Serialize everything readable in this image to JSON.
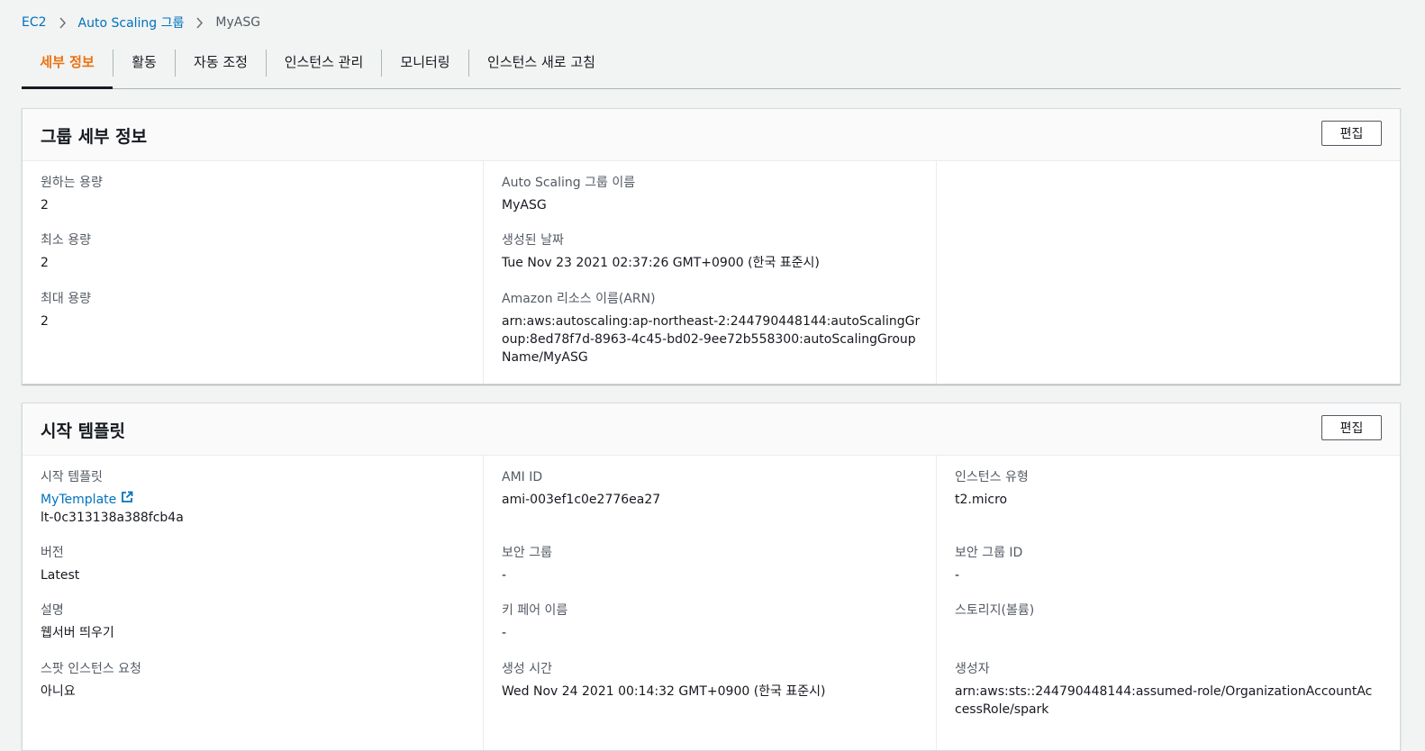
{
  "breadcrumb": {
    "items": [
      "EC2",
      "Auto Scaling 그룹"
    ],
    "current": "MyASG"
  },
  "tabs": [
    {
      "label": "세부 정보",
      "active": true
    },
    {
      "label": "활동"
    },
    {
      "label": "자동 조정"
    },
    {
      "label": "인스턴스 관리"
    },
    {
      "label": "모니터링"
    },
    {
      "label": "인스턴스 새로 고침"
    }
  ],
  "group_details": {
    "title": "그룹 세부 정보",
    "edit_label": "편집",
    "desired_label": "원하는 용량",
    "desired_value": "2",
    "min_label": "최소 용량",
    "min_value": "2",
    "max_label": "최대 용량",
    "max_value": "2",
    "name_label": "Auto Scaling 그룹 이름",
    "name_value": "MyASG",
    "created_label": "생성된 날짜",
    "created_value": "Tue Nov 23 2021 02:37:26 GMT+0900 (한국 표준시)",
    "arn_label": "Amazon 리소스 이름(ARN)",
    "arn_value": "arn:aws:autoscaling:ap-northeast-2:244790448144:autoScalingGroup:8ed78f7d-8963-4c45-bd02-9ee72b558300:autoScalingGroupName/MyASG"
  },
  "launch_template": {
    "title": "시작 템플릿",
    "edit_label": "편집",
    "template_label": "시작 템플릿",
    "template_name": "MyTemplate",
    "template_id": "lt-0c313138a388fcb4a",
    "version_label": "버전",
    "version_value": "Latest",
    "description_label": "설명",
    "description_value": "웹서버 띄우기",
    "spot_label": "스팟 인스턴스 요청",
    "spot_value": "아니요",
    "ami_label": "AMI ID",
    "ami_value": "ami-003ef1c0e2776ea27",
    "sg_label": "보안 그룹",
    "sg_value": "-",
    "keypair_label": "키 페어 이름",
    "keypair_value": "-",
    "created_time_label": "생성 시간",
    "created_time_value": "Wed Nov 24 2021 00:14:32 GMT+0900 (한국 표준시)",
    "instance_type_label": "인스턴스 유형",
    "instance_type_value": "t2.micro",
    "sg_id_label": "보안 그룹 ID",
    "sg_id_value": "-",
    "storage_label": "스토리지(볼륨)",
    "creator_label": "생성자",
    "creator_value": "arn:aws:sts::244790448144:assumed-role/OrganizationAccountAccessRole/spark"
  },
  "icons": {
    "separator": "chevron-right-icon",
    "external": "external-link-icon"
  },
  "colors": {
    "link": "#0073bb",
    "active_tab": "#ec7211",
    "background": "#f2f3f3"
  }
}
